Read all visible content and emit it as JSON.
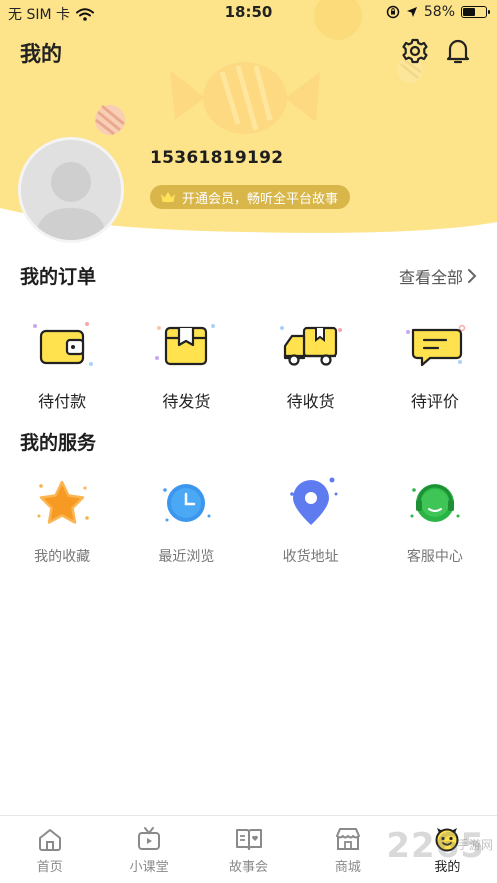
{
  "status_bar": {
    "carrier": "无 SIM 卡",
    "time": "18:50",
    "battery": "58%",
    "battery_level": 0.58
  },
  "header": {
    "title": "我的",
    "settings_icon": "gear-icon",
    "notification_icon": "bell-icon",
    "phone": "15361819192",
    "vip_text": "开通会员，畅听全平台故事",
    "accent_color": "#fde48a"
  },
  "orders": {
    "title": "我的订单",
    "view_all": "查看全部",
    "items": [
      {
        "label": "待付款",
        "icon": "wallet-icon"
      },
      {
        "label": "待发货",
        "icon": "package-icon"
      },
      {
        "label": "待收货",
        "icon": "truck-icon"
      },
      {
        "label": "待评价",
        "icon": "comment-icon"
      }
    ]
  },
  "services": {
    "title": "我的服务",
    "items": [
      {
        "label": "我的收藏",
        "icon": "star-icon"
      },
      {
        "label": "最近浏览",
        "icon": "clock-icon"
      },
      {
        "label": "收货地址",
        "icon": "location-pin-icon"
      },
      {
        "label": "客服中心",
        "icon": "headset-icon"
      }
    ]
  },
  "tabbar": {
    "items": [
      {
        "label": "首页",
        "icon": "home-icon"
      },
      {
        "label": "小课堂",
        "icon": "tv-icon"
      },
      {
        "label": "故事会",
        "icon": "book-icon"
      },
      {
        "label": "商城",
        "icon": "shop-icon"
      },
      {
        "label": "我的",
        "icon": "profile-face-icon"
      }
    ],
    "active_index": 4
  },
  "watermark": {
    "text": "2265",
    "sub": "手游网"
  }
}
